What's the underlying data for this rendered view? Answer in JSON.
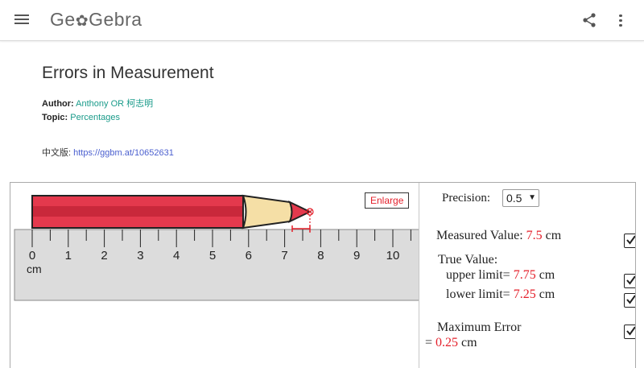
{
  "header": {
    "logo_text_1": "Ge",
    "logo_text_2": "Gebra",
    "icons": [
      "menu-icon",
      "flower-icon",
      "share-icon",
      "more-vertical-icon"
    ]
  },
  "material": {
    "title": "Errors in Measurement",
    "author_label": "Author:",
    "author_value": "Anthony OR 柯志明",
    "topic_label": "Topic:",
    "topic_value": "Percentages",
    "cn_label": "中文版:",
    "cn_url": "https://ggbm.at/10652631"
  },
  "applet": {
    "enlarge_label": "Enlarge",
    "ruler": {
      "ticks": [
        "0",
        "1",
        "2",
        "3",
        "4",
        "5",
        "6",
        "7",
        "8",
        "9",
        "10"
      ],
      "unit": "cm"
    },
    "pencil": {
      "length_value": 7.75,
      "body_color": "#e4394d",
      "wood_color": "#f5dfa6"
    },
    "colors": {
      "accent_red": "#e4202b"
    },
    "precision_label": "Precision:",
    "precision_value": "0.5",
    "measured_label": "Measured Value:",
    "measured_value": "7.5",
    "measured_unit": "cm",
    "true_value_label": "True Value:",
    "upper_label": "upper limit=",
    "upper_value": "7.75",
    "upper_unit": "cm",
    "lower_label": "lower limit=",
    "lower_value": "7.25",
    "lower_unit": "cm",
    "max_error_label": "Maximum Error",
    "max_error_eq": "=",
    "max_error_value": "0.25",
    "max_error_unit": "cm",
    "checkboxes": {
      "measured": true,
      "upper": true,
      "lower": true,
      "max_error": true
    }
  }
}
